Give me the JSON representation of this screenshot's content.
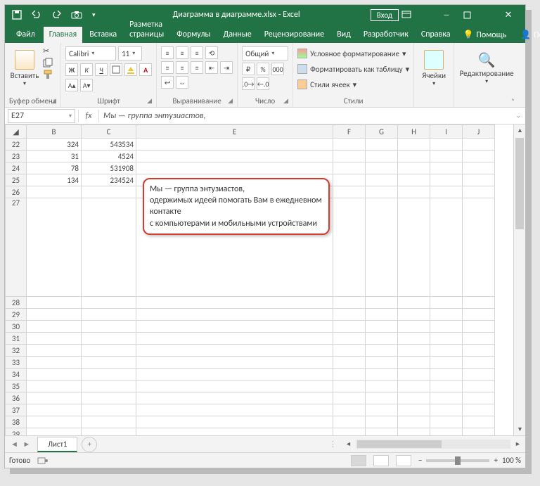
{
  "titlebar": {
    "title": "Диаграмма в диаграмме.xlsx - Excel",
    "login": "Вход"
  },
  "tabs": {
    "file": "Файл",
    "home": "Главная",
    "insert": "Вставка",
    "pagelayout": "Разметка страницы",
    "formulas": "Формулы",
    "data": "Данные",
    "review": "Рецензирование",
    "view": "Вид",
    "developer": "Разработчик",
    "help": "Справка",
    "tellme": "Помощь",
    "share": "Поделиться"
  },
  "ribbon": {
    "clipboard": {
      "label": "Буфер обмена",
      "paste": "Вставить"
    },
    "font": {
      "label": "Шрифт",
      "name": "Calibri",
      "size": "11"
    },
    "alignment": {
      "label": "Выравнивание"
    },
    "number": {
      "label": "Число",
      "format": "Общий"
    },
    "styles": {
      "label": "Стили",
      "cond": "Условное форматирование",
      "table": "Форматировать как таблицу",
      "cell": "Стили ячеек"
    },
    "cells": {
      "label": "Ячейки"
    },
    "editing": {
      "label": "Редактирование"
    }
  },
  "namebox": "E27",
  "formula": "Мы — группа энтузиастов,",
  "columns": [
    "B",
    "C",
    "E",
    "F",
    "G",
    "H",
    "I",
    "J"
  ],
  "rows": [
    {
      "n": 22,
      "b": "324",
      "c": "543534"
    },
    {
      "n": 23,
      "b": "31",
      "c": "4524"
    },
    {
      "n": 24,
      "b": "78",
      "c": "531908"
    },
    {
      "n": 25,
      "b": "134",
      "c": "234524"
    }
  ],
  "emptyrows_before": [
    26
  ],
  "bigrow": 27,
  "emptyrows_after": [
    28,
    29,
    30,
    31,
    32,
    33,
    34,
    35,
    36,
    37,
    38,
    39
  ],
  "textbox": {
    "l1": "Мы — группа энтузиастов,",
    "l2": "одержимых идеей помогать Вам в ежедневном",
    "l3": "контакте",
    "l4": "с компьютерами и мобильными устройствами"
  },
  "sheet_tab": "Лист1",
  "status": {
    "ready": "Готово",
    "zoom": "100 %"
  }
}
